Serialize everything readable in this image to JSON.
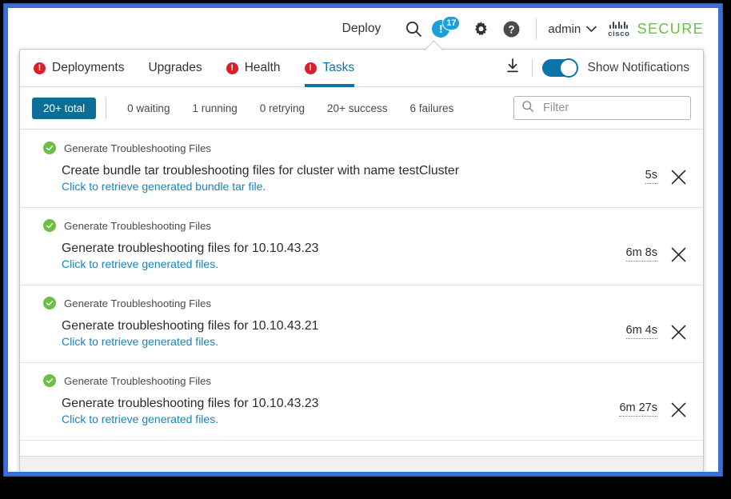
{
  "appbar": {
    "deploy_label": "Deploy",
    "search_icon": "search-icon",
    "notification_icon": "alert-circle-icon",
    "notification_mark": "!",
    "notification_count": "17",
    "settings_icon": "gear-icon",
    "help_icon": "help-circle-icon",
    "user_label": "admin",
    "user_caret": "chevron-down-icon",
    "brand_cisco": "cisco",
    "brand_secure": "SECURE"
  },
  "panel": {
    "tabs": [
      {
        "label": "Deployments",
        "alert": true,
        "alert_mark": "!",
        "active": false
      },
      {
        "label": "Upgrades",
        "alert": false,
        "alert_mark": "",
        "active": false
      },
      {
        "label": "Health",
        "alert": true,
        "alert_mark": "!",
        "active": false
      },
      {
        "label": "Tasks",
        "alert": true,
        "alert_mark": "!",
        "active": true
      }
    ],
    "download_icon": "download-icon",
    "toggle": {
      "name": "show-notifications-toggle",
      "state": "on",
      "label": "Show Notifications"
    },
    "chips": [
      {
        "label": "20+ total",
        "active": true
      },
      {
        "label": "0 waiting",
        "active": false
      },
      {
        "label": "1 running",
        "active": false
      },
      {
        "label": "0 retrying",
        "active": false
      },
      {
        "label": "20+ success",
        "active": false
      },
      {
        "label": "6 failures",
        "active": false
      }
    ],
    "search": {
      "placeholder": "Filter",
      "value": "",
      "icon": "search-icon"
    },
    "tasks": [
      {
        "status": "success",
        "type": "Generate Troubleshooting Files",
        "description": "Create bundle tar troubleshooting files for cluster with name testCluster",
        "link": "Click to retrieve generated bundle tar file.",
        "duration": "5s",
        "close_icon": "close-icon"
      },
      {
        "status": "success",
        "type": "Generate Troubleshooting Files",
        "description": "Generate troubleshooting files for 10.10.43.23",
        "link": "Click to retrieve generated files.",
        "duration": "6m 8s",
        "close_icon": "close-icon"
      },
      {
        "status": "success",
        "type": "Generate Troubleshooting Files",
        "description": "Generate troubleshooting files for 10.10.43.21",
        "link": "Click to retrieve generated files.",
        "duration": "6m 4s",
        "close_icon": "close-icon"
      },
      {
        "status": "success",
        "type": "Generate Troubleshooting Files",
        "description": "Generate troubleshooting files for 10.10.43.23",
        "link": "Click to retrieve generated files.",
        "duration": "6m 27s",
        "close_icon": "close-icon"
      }
    ]
  },
  "colors": {
    "accent_blue": "#0d74a8",
    "chip_active": "#0d6e95",
    "alert_red": "#d9202a",
    "success_green": "#6cbe45",
    "link_blue": "#1b83b8",
    "notify_blue": "#1ba0d7",
    "window_frame": "#3a6fd8"
  }
}
